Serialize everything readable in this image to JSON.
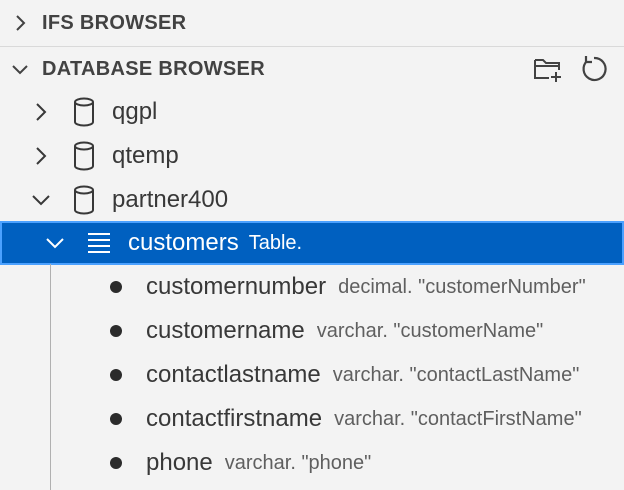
{
  "sections": {
    "ifs_browser": {
      "title": "IFS BROWSER",
      "expanded": false
    },
    "database_browser": {
      "title": "DATABASE BROWSER",
      "expanded": true
    }
  },
  "header_actions": {
    "new_schema_icon": "folder-add-icon",
    "refresh_icon": "refresh-icon"
  },
  "libraries": [
    {
      "name": "qgpl",
      "expanded": false
    },
    {
      "name": "qtemp",
      "expanded": false
    },
    {
      "name": "partner400",
      "expanded": true
    }
  ],
  "table": {
    "name": "customers",
    "type": "Table."
  },
  "columns": [
    {
      "name": "customernumber",
      "desc": "decimal. \"customerNumber\""
    },
    {
      "name": "customername",
      "desc": "varchar. \"customerName\""
    },
    {
      "name": "contactlastname",
      "desc": "varchar. \"contactLastName\""
    },
    {
      "name": "contactfirstname",
      "desc": "varchar. \"contactFirstName\""
    },
    {
      "name": "phone",
      "desc": "varchar. \"phone\""
    }
  ],
  "colors": {
    "selection": "#0060c0",
    "selection_border": "#4ba1ff",
    "background": "#f3f3f3"
  }
}
